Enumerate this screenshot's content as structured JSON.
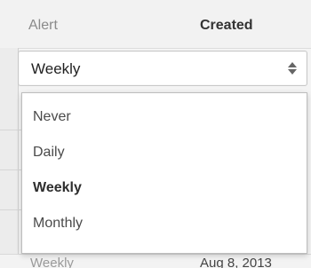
{
  "table": {
    "headers": {
      "alert": "Alert",
      "created": "Created"
    },
    "visible_row": {
      "alert": "Weekly",
      "created": "Aug 8, 2013"
    }
  },
  "select": {
    "value": "Weekly",
    "arrow_icon": "up-down-arrows-icon"
  },
  "dropdown": {
    "options": [
      {
        "label": "Never"
      },
      {
        "label": "Daily"
      },
      {
        "label": "Weekly",
        "selected": true
      },
      {
        "label": "Monthly"
      }
    ]
  },
  "colors": {
    "header_bg": "#f2f2f2",
    "border": "#c8c8c8",
    "muted_text": "#8a8a8a",
    "strong_text": "#333333",
    "dropdown_bg": "#ffffff"
  }
}
